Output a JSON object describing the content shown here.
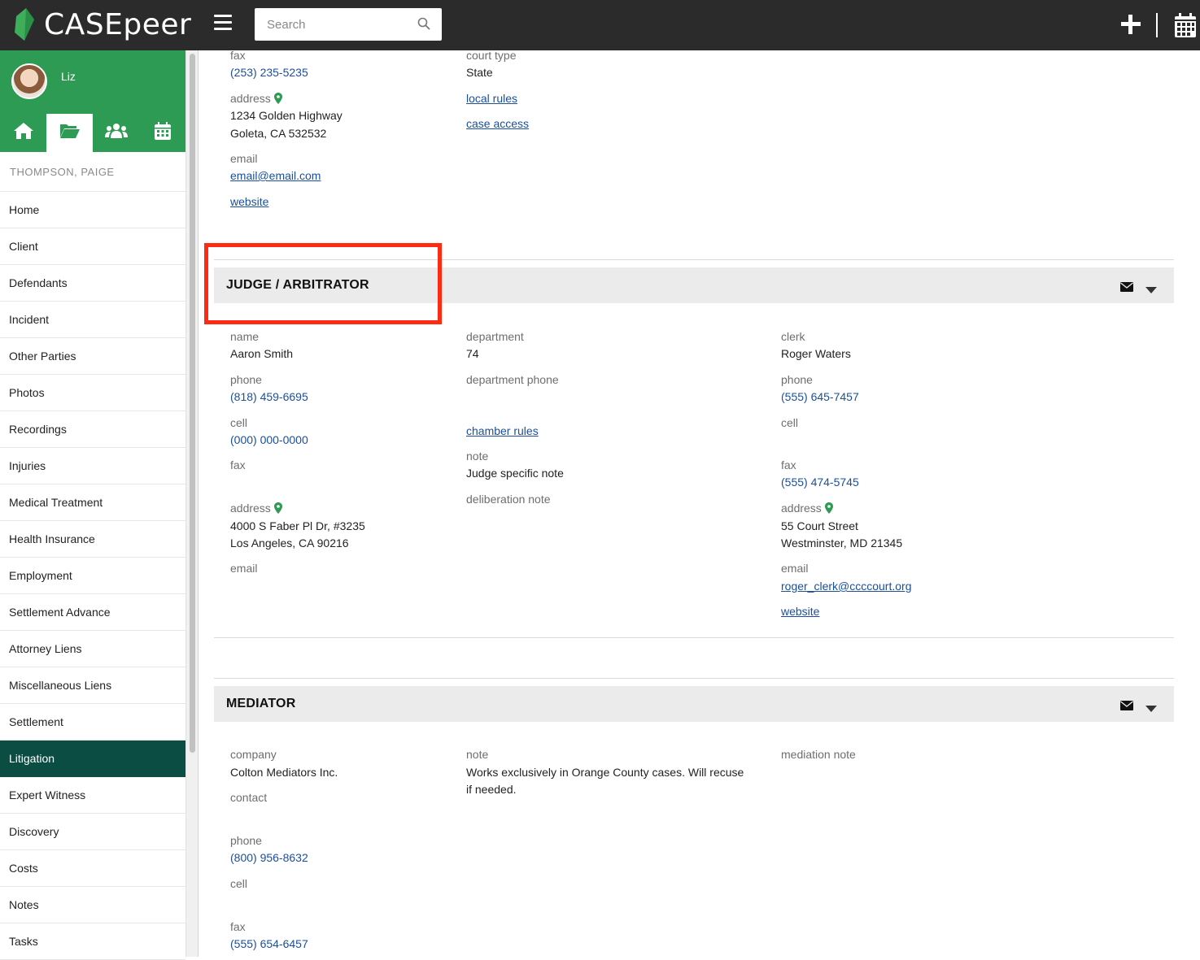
{
  "app": {
    "name": "CASEpeer"
  },
  "search": {
    "placeholder": "Search"
  },
  "user": {
    "name": "Liz"
  },
  "sidebar": {
    "case_name": "THOMPSON, PAIGE",
    "items": [
      {
        "label": "Home"
      },
      {
        "label": "Client"
      },
      {
        "label": "Defendants"
      },
      {
        "label": "Incident"
      },
      {
        "label": "Other Parties"
      },
      {
        "label": "Photos"
      },
      {
        "label": "Recordings"
      },
      {
        "label": "Injuries"
      },
      {
        "label": "Medical Treatment"
      },
      {
        "label": "Health Insurance"
      },
      {
        "label": "Employment"
      },
      {
        "label": "Settlement Advance"
      },
      {
        "label": "Attorney Liens"
      },
      {
        "label": "Miscellaneous Liens"
      },
      {
        "label": "Settlement"
      },
      {
        "label": "Litigation"
      },
      {
        "label": "Expert Witness"
      },
      {
        "label": "Discovery"
      },
      {
        "label": "Costs"
      },
      {
        "label": "Notes"
      },
      {
        "label": "Tasks"
      }
    ],
    "active_item": "Litigation"
  },
  "court": {
    "fax_label": "fax",
    "fax": "(253) 235-5235",
    "address_label": "address",
    "address_line1": "1234 Golden Highway",
    "address_line2": "Goleta, CA 532532",
    "email_label": "email",
    "email": "email@email.com",
    "website": "website",
    "court_type_label": "court type",
    "court_type": "State",
    "local_rules": "local rules",
    "case_access": "case access"
  },
  "judge": {
    "title": "JUDGE / ARBITRATOR",
    "name_label": "name",
    "name": "Aaron Smith",
    "phone_label": "phone",
    "phone": "(818) 459-6695",
    "cell_label": "cell",
    "cell": "(000) 000-0000",
    "fax_label": "fax",
    "address_label": "address",
    "address_line1": "4000 S Faber Pl Dr, #3235",
    "address_line2": "Los Angeles, CA 90216",
    "email_label": "email",
    "department_label": "department",
    "department": "74",
    "department_phone_label": "department phone",
    "chamber_rules": "chamber rules",
    "note_label": "note",
    "note": "Judge specific note",
    "deliberation_note_label": "deliberation note",
    "clerk_label": "clerk",
    "clerk": "Roger Waters",
    "clerk_phone_label": "phone",
    "clerk_phone": "(555) 645-7457",
    "clerk_cell_label": "cell",
    "clerk_fax_label": "fax",
    "clerk_fax": "(555) 474-5745",
    "clerk_address_label": "address",
    "clerk_address_line1": "55 Court Street",
    "clerk_address_line2": "Westminster, MD 21345",
    "clerk_email_label": "email",
    "clerk_email": "roger_clerk@ccccourt.org",
    "clerk_website": "website"
  },
  "mediator": {
    "title": "MEDIATOR",
    "company_label": "company",
    "company": "Colton Mediators Inc.",
    "contact_label": "contact",
    "phone_label": "phone",
    "phone": "(800) 956-8632",
    "cell_label": "cell",
    "fax_label": "fax",
    "fax": "(555) 654-6457",
    "note_label": "note",
    "note_line1": "Works exclusively in Orange County cases. Will recuse",
    "note_line2": "if needed.",
    "mediation_note_label": "mediation note"
  },
  "colors": {
    "brand_green": "#2e9b54",
    "active_nav": "#0b4d42",
    "topbar": "#2b2b2b",
    "link": "#1a4f9c",
    "highlight": "#ff2a12"
  },
  "icons": [
    "logo-leaf-icon",
    "hamburger-icon",
    "search-icon",
    "plus-icon",
    "calendar-icon",
    "home-icon",
    "folder-open-icon",
    "users-icon",
    "calendar-small-icon",
    "map-pin-icon",
    "envelope-icon",
    "caret-down-icon"
  ]
}
